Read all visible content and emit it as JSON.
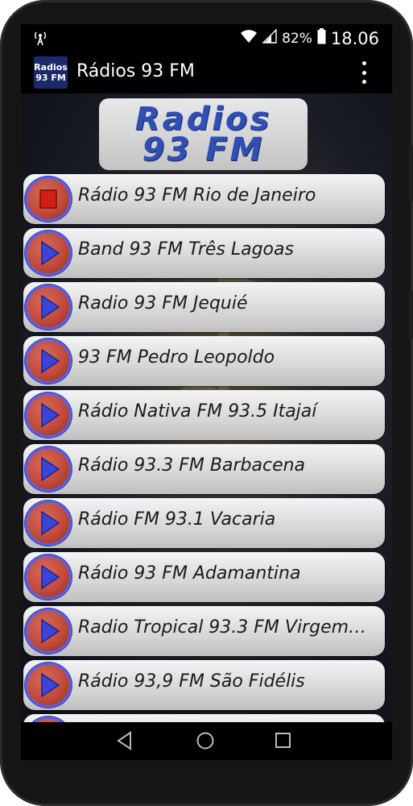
{
  "status_bar": {
    "battery_percent": "82%",
    "time": "18.06",
    "icons": [
      "radio-tower-icon",
      "wifi-icon",
      "signal-icon",
      "battery-icon"
    ]
  },
  "app_bar": {
    "app_icon_line1": "Radios",
    "app_icon_line2": "93 FM",
    "title": "Rádios 93 FM"
  },
  "logo": {
    "line1": "Radios",
    "line2": "93 FM"
  },
  "stations": [
    {
      "name": "Rádio 93 FM Rio de Janeiro",
      "state": "playing"
    },
    {
      "name": "Band 93 FM Três Lagoas",
      "state": "stopped"
    },
    {
      "name": "Radio 93 FM Jequié",
      "state": "stopped"
    },
    {
      "name": "93 FM Pedro Leopoldo",
      "state": "stopped"
    },
    {
      "name": "Rádio Nativa FM 93.5 Itajaí",
      "state": "stopped"
    },
    {
      "name": "Rádio 93.3 FM Barbacena",
      "state": "stopped"
    },
    {
      "name": "Rádio FM 93.1 Vacaria",
      "state": "stopped"
    },
    {
      "name": "Rádio 93 FM Adamantina",
      "state": "stopped"
    },
    {
      "name": "Radio Tropical 93.3 FM Virgem…",
      "state": "stopped"
    },
    {
      "name": "Rádio 93,9 FM São Fidélis",
      "state": "stopped"
    }
  ],
  "colors": {
    "accent_blue": "#2f4fb5",
    "button_red": "#c24b3b",
    "button_ring": "#5b5fe0"
  }
}
